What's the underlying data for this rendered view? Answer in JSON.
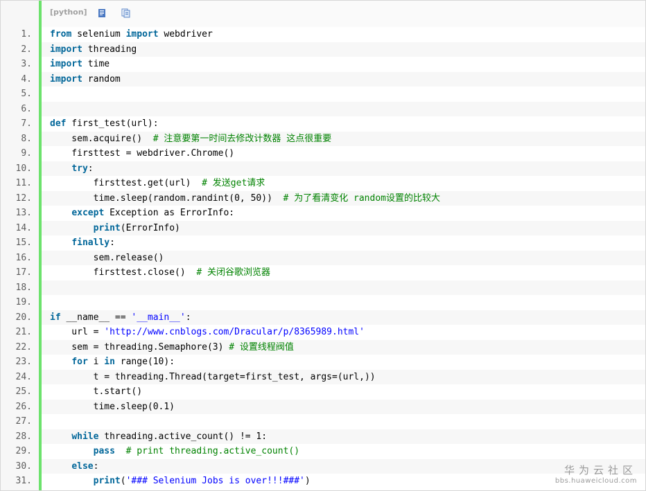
{
  "toolbar": {
    "language_label": "[python]",
    "view_icon": "view-source-icon",
    "copy_icon": "copy-icon"
  },
  "code_lines": [
    {
      "n": "1.",
      "tokens": [
        {
          "t": "from",
          "c": "kw"
        },
        {
          "t": " selenium "
        },
        {
          "t": "import",
          "c": "kw"
        },
        {
          "t": " webdriver"
        }
      ]
    },
    {
      "n": "2.",
      "tokens": [
        {
          "t": "import",
          "c": "kw"
        },
        {
          "t": " threading"
        }
      ]
    },
    {
      "n": "3.",
      "tokens": [
        {
          "t": "import",
          "c": "kw"
        },
        {
          "t": " time"
        }
      ]
    },
    {
      "n": "4.",
      "tokens": [
        {
          "t": "import",
          "c": "kw"
        },
        {
          "t": " random"
        }
      ]
    },
    {
      "n": "5.",
      "tokens": []
    },
    {
      "n": "6.",
      "tokens": []
    },
    {
      "n": "7.",
      "tokens": [
        {
          "t": "def",
          "c": "kw"
        },
        {
          "t": " first_test(url):"
        }
      ]
    },
    {
      "n": "8.",
      "tokens": [
        {
          "t": "    sem.acquire()  "
        },
        {
          "t": "# 注意要第一时间去修改计数器 这点很重要",
          "c": "cm"
        }
      ]
    },
    {
      "n": "9.",
      "tokens": [
        {
          "t": "    firsttest = webdriver.Chrome()"
        }
      ]
    },
    {
      "n": "10.",
      "tokens": [
        {
          "t": "    "
        },
        {
          "t": "try",
          "c": "kw"
        },
        {
          "t": ":"
        }
      ]
    },
    {
      "n": "11.",
      "tokens": [
        {
          "t": "        firsttest.get(url)  "
        },
        {
          "t": "# 发送get请求",
          "c": "cm"
        }
      ]
    },
    {
      "n": "12.",
      "tokens": [
        {
          "t": "        time.sleep(random.randint(0, 50))  "
        },
        {
          "t": "# 为了看清变化 random设置的比较大",
          "c": "cm"
        }
      ]
    },
    {
      "n": "13.",
      "tokens": [
        {
          "t": "    "
        },
        {
          "t": "except",
          "c": "kw"
        },
        {
          "t": " Exception as ErrorInfo:"
        }
      ]
    },
    {
      "n": "14.",
      "tokens": [
        {
          "t": "        "
        },
        {
          "t": "print",
          "c": "kw"
        },
        {
          "t": "(ErrorInfo)"
        }
      ]
    },
    {
      "n": "15.",
      "tokens": [
        {
          "t": "    "
        },
        {
          "t": "finally",
          "c": "kw"
        },
        {
          "t": ":"
        }
      ]
    },
    {
      "n": "16.",
      "tokens": [
        {
          "t": "        sem.release()"
        }
      ]
    },
    {
      "n": "17.",
      "tokens": [
        {
          "t": "        firsttest.close()  "
        },
        {
          "t": "# 关闭谷歌浏览器",
          "c": "cm"
        }
      ]
    },
    {
      "n": "18.",
      "tokens": []
    },
    {
      "n": "19.",
      "tokens": []
    },
    {
      "n": "20.",
      "tokens": [
        {
          "t": "if",
          "c": "kw"
        },
        {
          "t": " __name__ == "
        },
        {
          "t": "'__main__'",
          "c": "str"
        },
        {
          "t": ":"
        }
      ]
    },
    {
      "n": "21.",
      "tokens": [
        {
          "t": "    url = "
        },
        {
          "t": "'http://www.cnblogs.com/Dracular/p/8365989.html'",
          "c": "str"
        }
      ]
    },
    {
      "n": "22.",
      "tokens": [
        {
          "t": "    sem = threading.Semaphore(3) "
        },
        {
          "t": "# 设置线程阀值",
          "c": "cm"
        }
      ]
    },
    {
      "n": "23.",
      "tokens": [
        {
          "t": "    "
        },
        {
          "t": "for",
          "c": "kw"
        },
        {
          "t": " i "
        },
        {
          "t": "in",
          "c": "kw"
        },
        {
          "t": " range(10):"
        }
      ]
    },
    {
      "n": "24.",
      "tokens": [
        {
          "t": "        t = threading.Thread(target=first_test, args=(url,))"
        }
      ]
    },
    {
      "n": "25.",
      "tokens": [
        {
          "t": "        t.start()"
        }
      ]
    },
    {
      "n": "26.",
      "tokens": [
        {
          "t": "        time.sleep(0.1)"
        }
      ]
    },
    {
      "n": "27.",
      "tokens": []
    },
    {
      "n": "28.",
      "tokens": [
        {
          "t": "    "
        },
        {
          "t": "while",
          "c": "kw"
        },
        {
          "t": " threading.active_count() != 1:"
        }
      ]
    },
    {
      "n": "29.",
      "tokens": [
        {
          "t": "        "
        },
        {
          "t": "pass",
          "c": "kw"
        },
        {
          "t": "  "
        },
        {
          "t": "# print threading.active_count()",
          "c": "cm"
        }
      ]
    },
    {
      "n": "30.",
      "tokens": [
        {
          "t": "    "
        },
        {
          "t": "else",
          "c": "kw"
        },
        {
          "t": ":"
        }
      ]
    },
    {
      "n": "31.",
      "tokens": [
        {
          "t": "        "
        },
        {
          "t": "print",
          "c": "kw"
        },
        {
          "t": "("
        },
        {
          "t": "'### Selenium Jobs is over!!!###'",
          "c": "str"
        },
        {
          "t": ")"
        }
      ]
    }
  ],
  "watermark": {
    "title": "华为云社区",
    "url": "bbs.huaweicloud.com"
  },
  "colors": {
    "keyword": "#006699",
    "string": "#0000ff",
    "comment": "#008200",
    "gutter_bar": "#6ce26c"
  }
}
